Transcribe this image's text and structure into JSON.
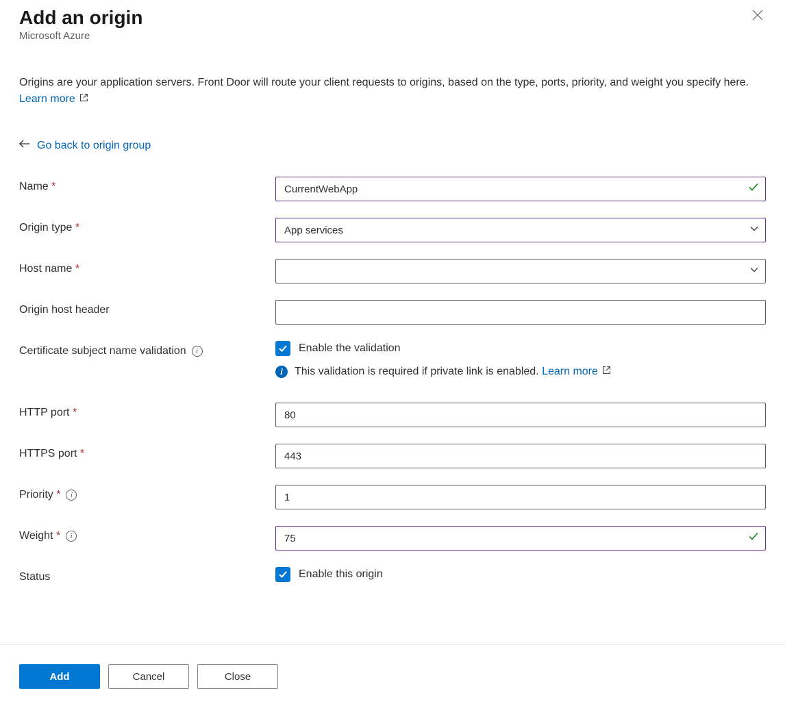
{
  "header": {
    "title": "Add an origin",
    "subtitle": "Microsoft Azure"
  },
  "description": {
    "text": "Origins are your application servers. Front Door will route your client requests to origins, based on the type, ports, priority, and weight you specify here. ",
    "learn_more": "Learn more"
  },
  "back_link": "Go back to origin group",
  "fields": {
    "name": {
      "label": "Name",
      "value": "CurrentWebApp"
    },
    "origin_type": {
      "label": "Origin type",
      "value": "App services"
    },
    "host_name": {
      "label": "Host name",
      "value": ""
    },
    "origin_host_header": {
      "label": "Origin host header",
      "value": ""
    },
    "cert_validation": {
      "label": "Certificate subject name validation",
      "checkbox_label": "Enable the validation",
      "info_text": "This validation is required if private link is enabled. ",
      "learn_more": "Learn more"
    },
    "http_port": {
      "label": "HTTP port",
      "value": "80"
    },
    "https_port": {
      "label": "HTTPS port",
      "value": "443"
    },
    "priority": {
      "label": "Priority",
      "value": "1"
    },
    "weight": {
      "label": "Weight",
      "value": "75"
    },
    "status": {
      "label": "Status",
      "checkbox_label": "Enable this origin"
    }
  },
  "footer": {
    "add": "Add",
    "cancel": "Cancel",
    "close": "Close"
  }
}
